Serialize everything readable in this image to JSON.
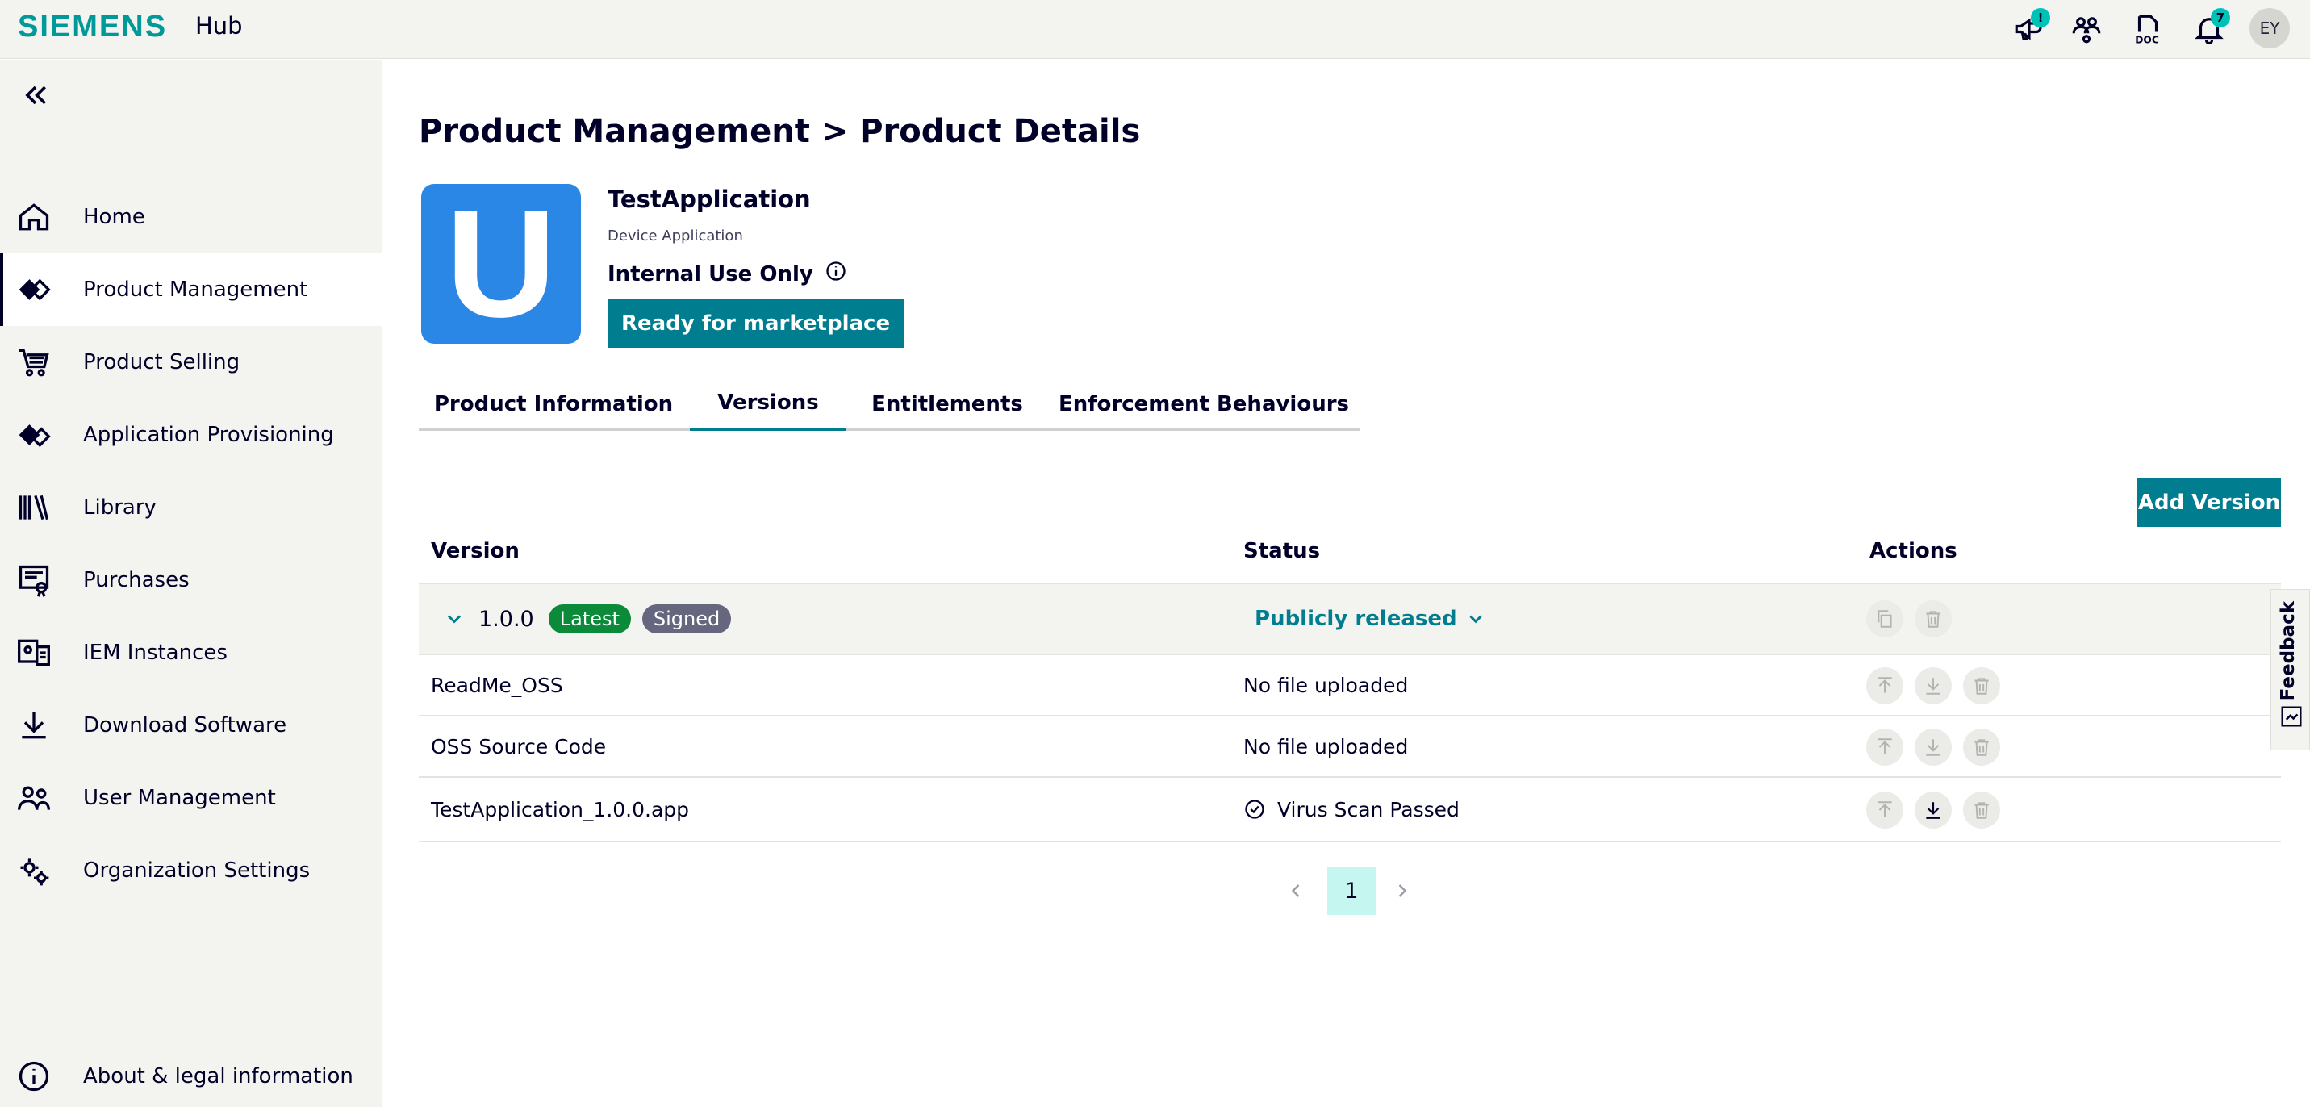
{
  "header": {
    "brand": "SIEMENS",
    "app_name": "Hub",
    "icons": [
      "megaphone-icon",
      "users-connect-icon",
      "doc-icon",
      "bell-icon"
    ],
    "megaphone_badge": "!",
    "bell_badge": "7",
    "avatar_initials": "EY"
  },
  "sidebar": {
    "items": [
      {
        "label": "Home",
        "icon": "home-icon"
      },
      {
        "label": "Product Management",
        "icon": "product-icon",
        "active": true
      },
      {
        "label": "Product Selling",
        "icon": "cart-icon"
      },
      {
        "label": "Application Provisioning",
        "icon": "provisioning-icon"
      },
      {
        "label": "Library",
        "icon": "library-icon"
      },
      {
        "label": "Purchases",
        "icon": "purchases-icon"
      },
      {
        "label": "IEM Instances",
        "icon": "iem-icon"
      },
      {
        "label": "Download Software",
        "icon": "download-icon"
      },
      {
        "label": "User Management",
        "icon": "users-icon"
      },
      {
        "label": "Organization Settings",
        "icon": "settings-icon"
      }
    ],
    "footer_label": "About & legal information"
  },
  "page": {
    "breadcrumb": "Product Management > Product Details",
    "app_icon_letter": "U",
    "app_name": "TestApplication",
    "app_type": "Device Application",
    "visibility": "Internal Use Only",
    "status_button": "Ready for marketplace"
  },
  "tabs": [
    {
      "label": "Product Information"
    },
    {
      "label": "Versions",
      "active": true
    },
    {
      "label": "Entitlements"
    },
    {
      "label": "Enforcement Behaviours"
    }
  ],
  "versions": {
    "add_button": "Add Version",
    "columns": [
      "Version",
      "Status",
      "Actions"
    ],
    "version_row": {
      "version": "1.0.0",
      "badges": [
        "Latest",
        "Signed"
      ],
      "status": "Publicly released"
    },
    "files": [
      {
        "name": "ReadMe_OSS",
        "status": "No file uploaded"
      },
      {
        "name": "OSS Source Code",
        "status": "No file uploaded"
      },
      {
        "name": "TestApplication_1.0.0.app",
        "status": "Virus Scan Passed"
      }
    ],
    "pagination": {
      "current": "1"
    }
  },
  "feedback_label": "Feedback"
}
